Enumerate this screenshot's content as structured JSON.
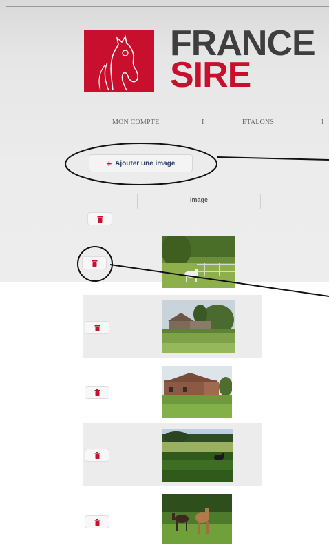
{
  "brand": {
    "line1": "FRANCE",
    "line2": "SIRE",
    "red": "#c8102e",
    "grey": "#3e3e3e"
  },
  "nav": {
    "items": [
      "MON COMPTE",
      "ETALONS"
    ],
    "separator": "I"
  },
  "toolbar": {
    "add_image_label": "Ajouter une image",
    "add_icon": "plus-icon"
  },
  "table": {
    "header": "Image",
    "rows": [
      {
        "thumbnail": "horse in fenced meadow"
      },
      {
        "thumbnail": "village houses on hillside"
      },
      {
        "thumbnail": "farm buildings and field"
      },
      {
        "thumbnail": "horse in green pasture"
      },
      {
        "thumbnail": "mare and foal in field"
      }
    ],
    "delete_icon": "trash-icon"
  }
}
